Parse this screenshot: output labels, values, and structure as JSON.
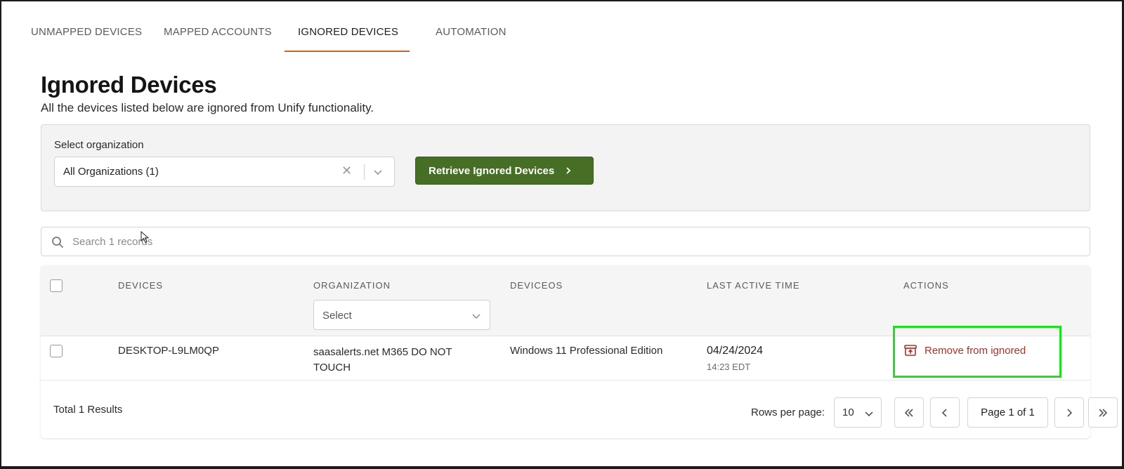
{
  "tabs": [
    {
      "label": "UNMAPPED DEVICES"
    },
    {
      "label": "MAPPED ACCOUNTS"
    },
    {
      "label": "IGNORED DEVICES",
      "active": true
    },
    {
      "label": "AUTOMATION"
    }
  ],
  "header": {
    "title": "Ignored Devices",
    "subtitle": "All the devices listed below are ignored from Unify functionality."
  },
  "filter": {
    "label": "Select organization",
    "selected": "All Organizations (1)",
    "retrieve_label": "Retrieve Ignored Devices"
  },
  "search": {
    "placeholder": "Search 1 records"
  },
  "table": {
    "columns": [
      "DEVICES",
      "ORGANIZATION",
      "DEVICEOS",
      "LAST ACTIVE TIME",
      "ACTIONS"
    ],
    "org_filter_placeholder": "Select",
    "rows": [
      {
        "device": "DESKTOP-L9LM0QP",
        "organization": "saasalerts.net M365 DO NOT TOUCH",
        "os": "Windows 11 Professional Edition",
        "date": "04/24/2024",
        "time": "14:23 EDT",
        "action_label": "Remove from ignored"
      }
    ]
  },
  "footer": {
    "total": "Total 1 Results",
    "rows_per_page_label": "Rows per page:",
    "rows_per_page_value": "10",
    "page_indicator": "Page 1 of 1"
  },
  "colors": {
    "accent": "#c8652a",
    "primary_button": "#476e25",
    "danger": "#a8322a",
    "highlight": "#1ee01e"
  }
}
